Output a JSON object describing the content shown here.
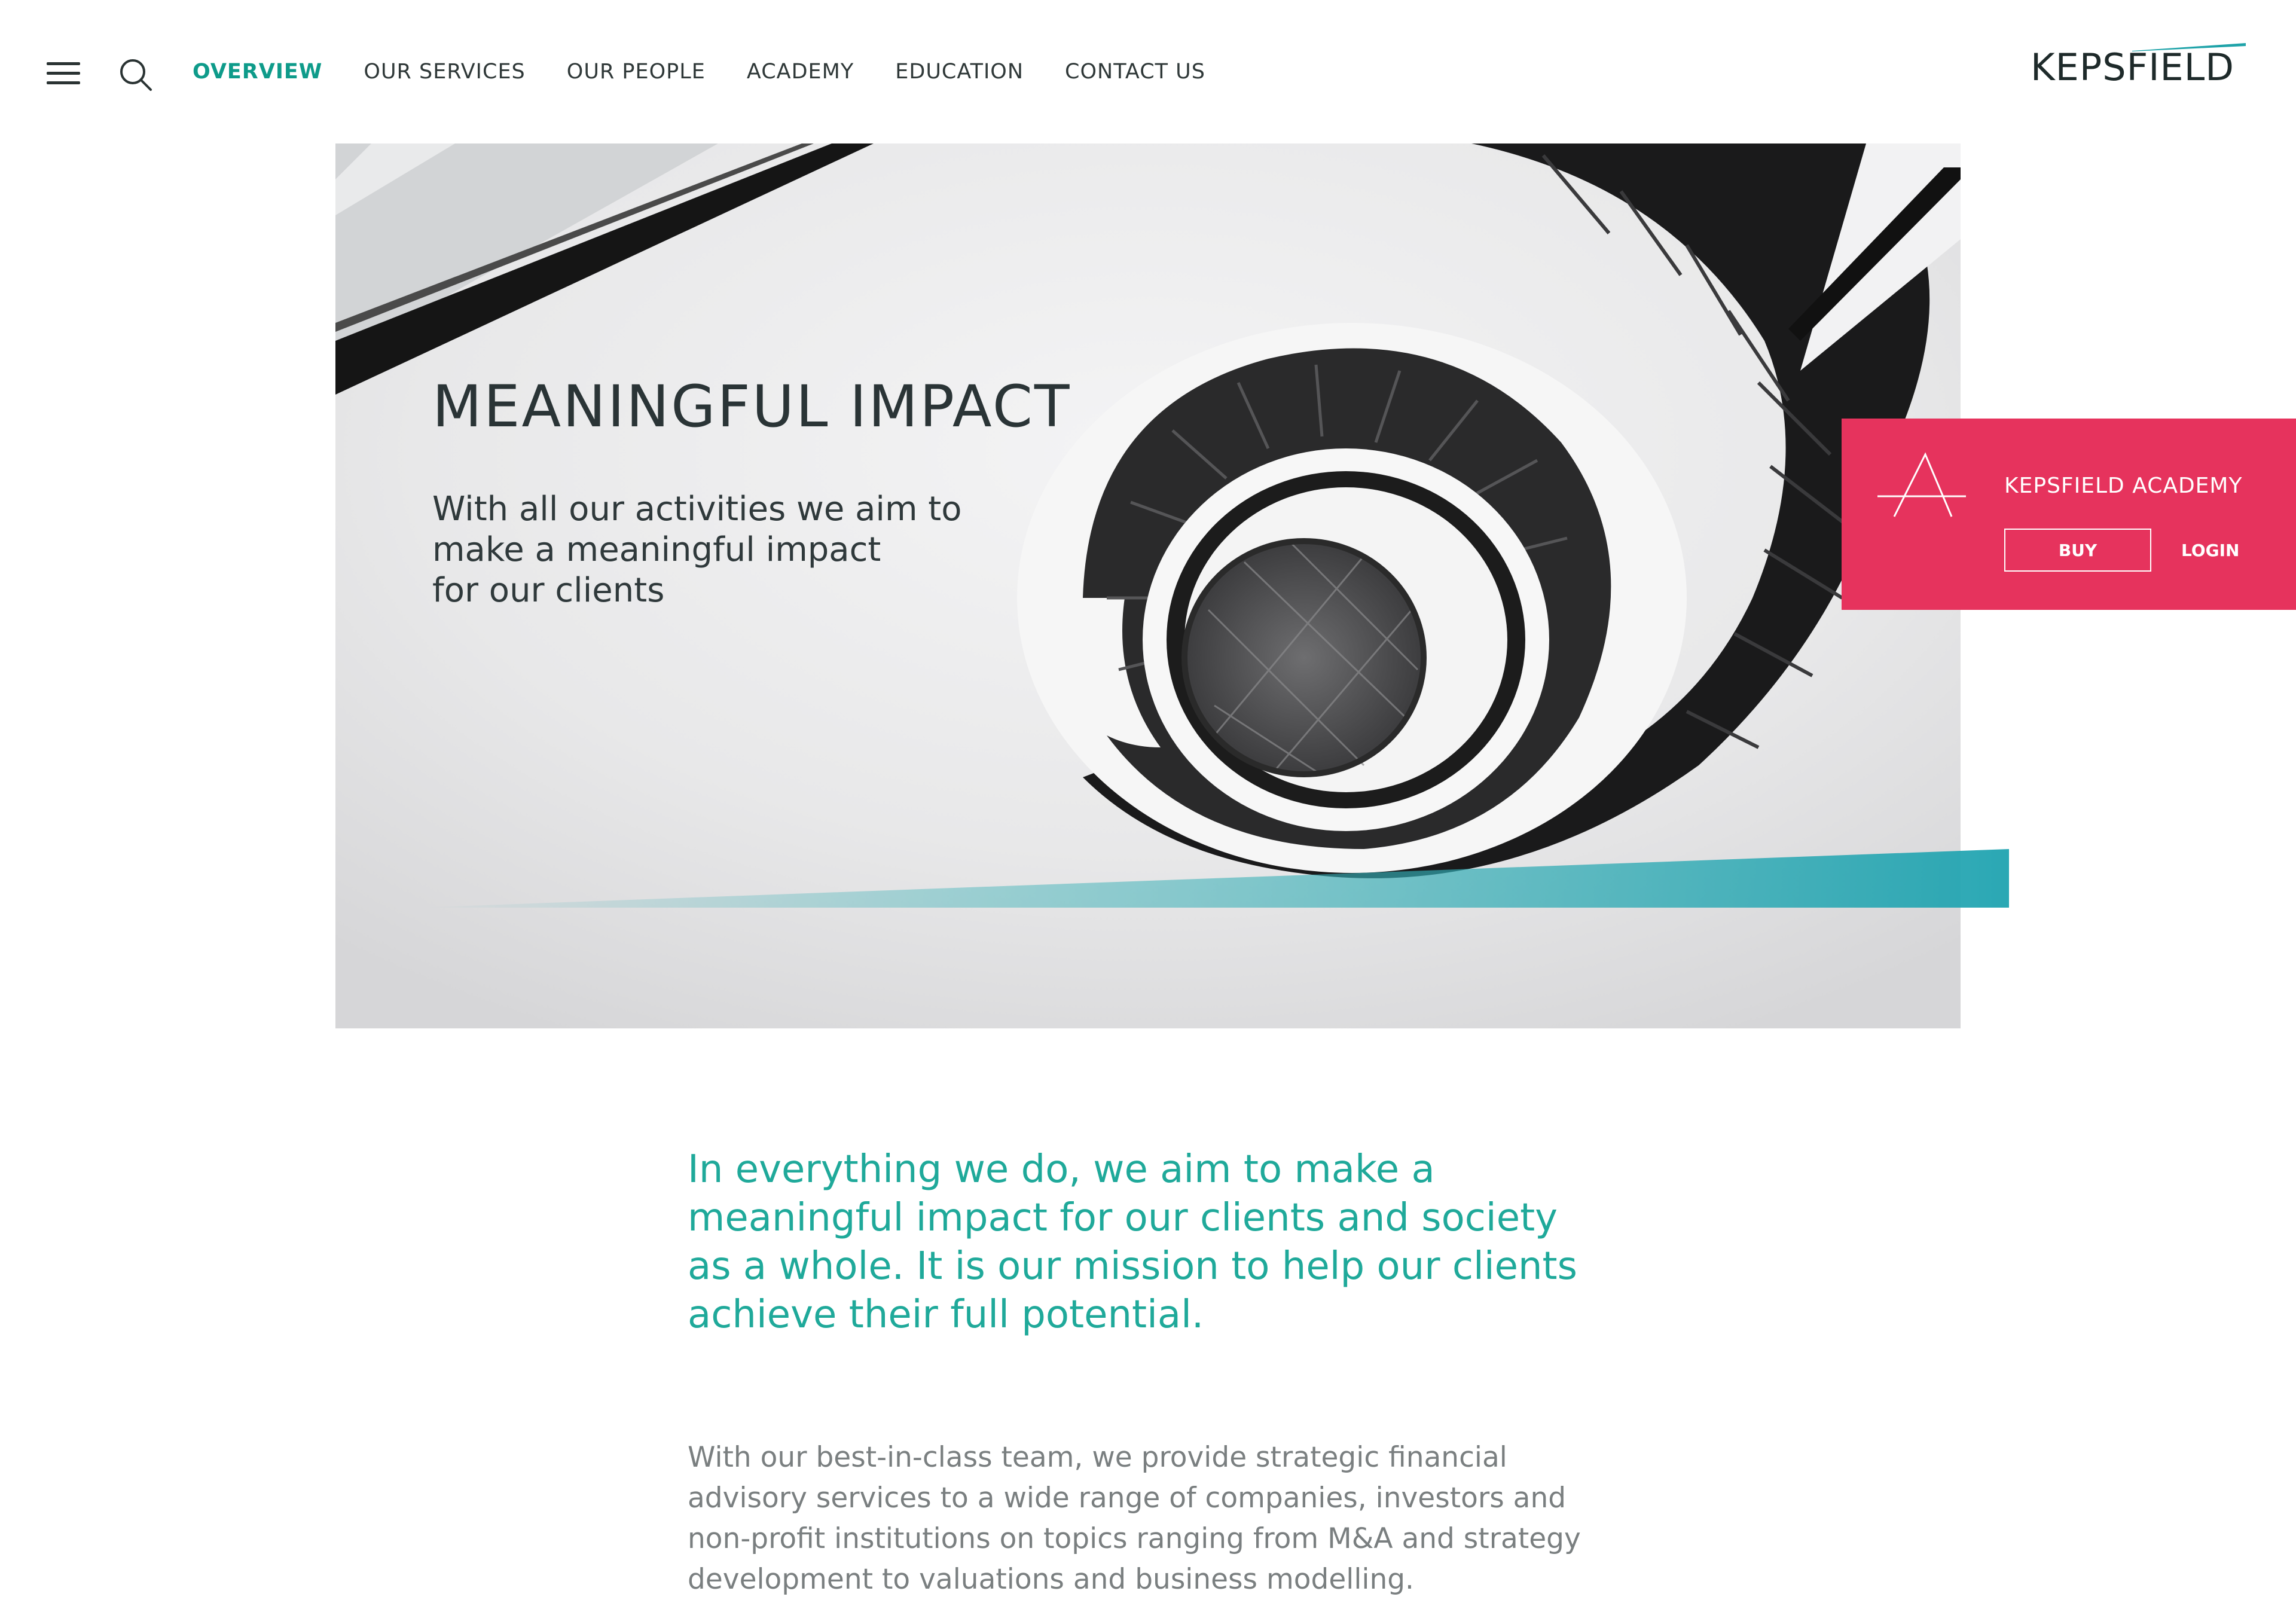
{
  "header": {
    "nav": [
      {
        "label": "OVERVIEW",
        "active": true
      },
      {
        "label": "OUR SERVICES",
        "active": false
      },
      {
        "label": "OUR PEOPLE",
        "active": false
      },
      {
        "label": "ACADEMY",
        "active": false
      },
      {
        "label": "EDUCATION",
        "active": false
      },
      {
        "label": "CONTACT US",
        "active": false
      }
    ],
    "logo_text": "KEPSFIELD",
    "icons": {
      "menu": "hamburger-icon",
      "search": "search-icon"
    }
  },
  "hero": {
    "title": "MEANINGFUL IMPACT",
    "subtitle_lines": [
      "With all our activities we aim to",
      "make a meaningful impact",
      "for our clients"
    ]
  },
  "academy": {
    "title": "KEPSFIELD ACADEMY",
    "buy_label": "BUY",
    "login_label": "LOGIN",
    "color": "#e6335d"
  },
  "content": {
    "lead_lines": [
      "In everything we do, we aim to make a",
      "meaningful impact for our clients and society",
      "as a whole. It is our mission to help our clients",
      "achieve their full potential."
    ],
    "body_lines": [
      "With our best-in-class team, we provide strategic financial",
      "advisory services to a wide range of companies, investors and",
      "non-profit institutions on topics ranging from M&A and strategy",
      "development to valuations and business modelling."
    ]
  },
  "colors": {
    "accent": "#0e9b8a",
    "teal": "#1fa99a",
    "academy": "#e6335d"
  }
}
